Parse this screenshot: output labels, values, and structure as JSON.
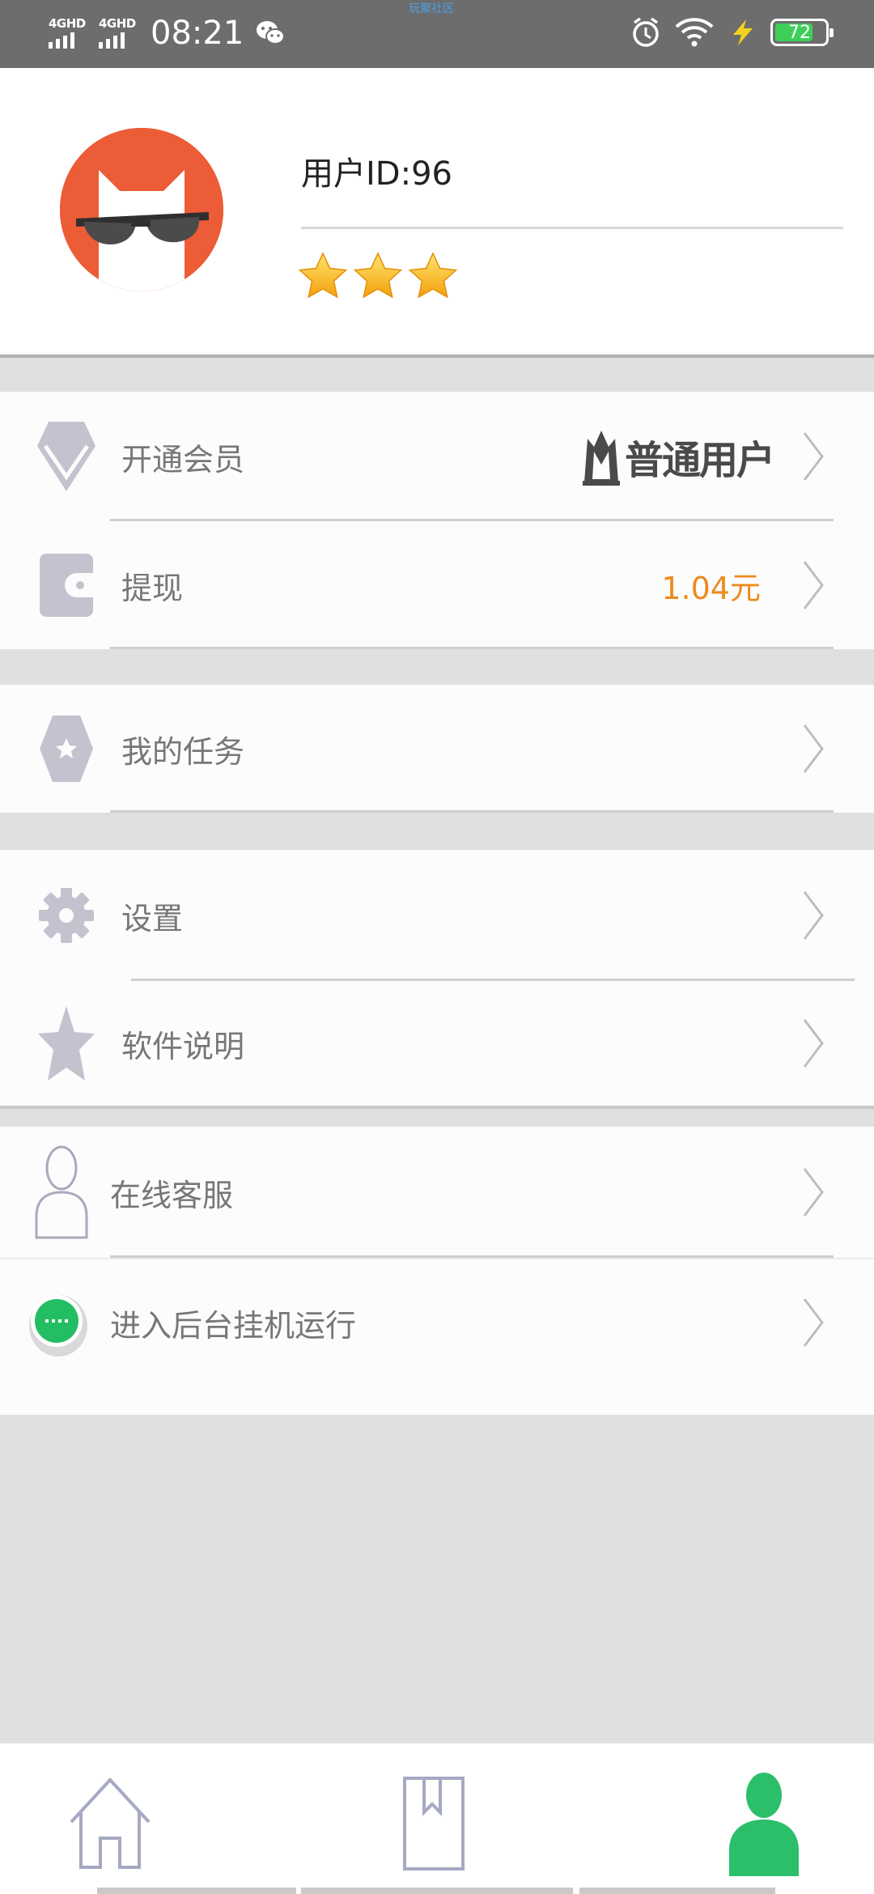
{
  "status_bar": {
    "network_1": "4GHD",
    "network_2": "4GHD",
    "time": "08:21",
    "top_center_text": "玩聚社区",
    "battery": "72"
  },
  "profile": {
    "user_id": "用户ID:96",
    "star_rating": 3
  },
  "menu": {
    "vip": {
      "label": "开通会员",
      "tier": "普通用户"
    },
    "withdraw": {
      "label": "提现",
      "amount": "1.04元"
    },
    "tasks": {
      "label": "我的任务"
    },
    "settings": {
      "label": "设置"
    },
    "manual": {
      "label": "软件说明"
    },
    "support": {
      "label": "在线客服"
    },
    "background": {
      "label": "进入后台挂机运行"
    }
  },
  "tabbar": {
    "tabs": [
      {
        "icon": "home-icon",
        "active": false
      },
      {
        "icon": "bookmark-book-icon",
        "active": false
      },
      {
        "icon": "person-icon",
        "active": true
      }
    ]
  },
  "colors": {
    "accent_green": "#2bbf6a",
    "amount_orange": "#ee8a1d",
    "icon_gray": "#c3c3d0",
    "avatar_orange": "#ec5c37"
  }
}
